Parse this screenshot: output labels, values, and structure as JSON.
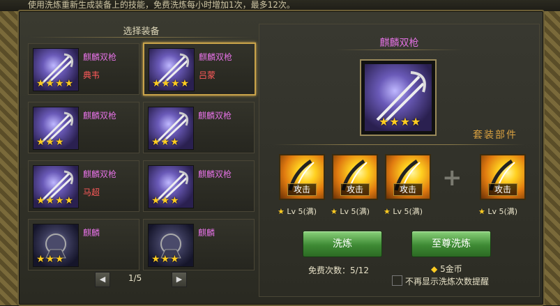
{
  "notice": "使用洗炼重新生成装备上的技能，免费洗炼每小时增加1次，最多12次。",
  "left": {
    "section_title": "选择装备",
    "cards": [
      {
        "name": "麒麟双枪",
        "owner": "典韦",
        "stars": "★★★★",
        "selected": false
      },
      {
        "name": "麒麟双枪",
        "owner": "吕蒙",
        "stars": "★★★★",
        "selected": true
      },
      {
        "name": "麒麟双枪",
        "owner": "",
        "stars": "★★★",
        "selected": false
      },
      {
        "name": "麒麟双枪",
        "owner": "",
        "stars": "★★★",
        "selected": false
      },
      {
        "name": "麒麟双枪",
        "owner": "马超",
        "stars": "★★★★",
        "selected": false
      },
      {
        "name": "麒麟双枪",
        "owner": "",
        "stars": "★★★",
        "selected": false
      },
      {
        "name": "麒麟",
        "owner": "",
        "stars": "★★★",
        "selected": false
      },
      {
        "name": "麒麟",
        "owner": "",
        "stars": "★★★",
        "selected": false
      }
    ],
    "pager": {
      "prev": "◀",
      "next": "▶",
      "page_text": "1/5"
    }
  },
  "right": {
    "weapon_title": "麒麟双枪",
    "weapon_stars": "★★★★",
    "set_title": "套装部件",
    "slots": [
      {
        "label": "攻击",
        "level": "Lv 5(满)"
      },
      {
        "label": "攻击",
        "level": "Lv 5(满)"
      },
      {
        "label": "攻击",
        "level": "Lv 5(满)"
      },
      {
        "label": "攻击",
        "level": "Lv 5(满)"
      }
    ],
    "plus": "+",
    "wash_button": "洗炼",
    "supreme_button": "至尊洗炼",
    "free_times": "免费次数：5/12",
    "gold_cost": "5金币",
    "no_remind": "不再显示洗炼次数提醒"
  },
  "colors": {
    "item_name": "#e070e0",
    "owner": "#ff5a5a",
    "star": "#ffcc22",
    "button_green": "#3e8a34"
  }
}
